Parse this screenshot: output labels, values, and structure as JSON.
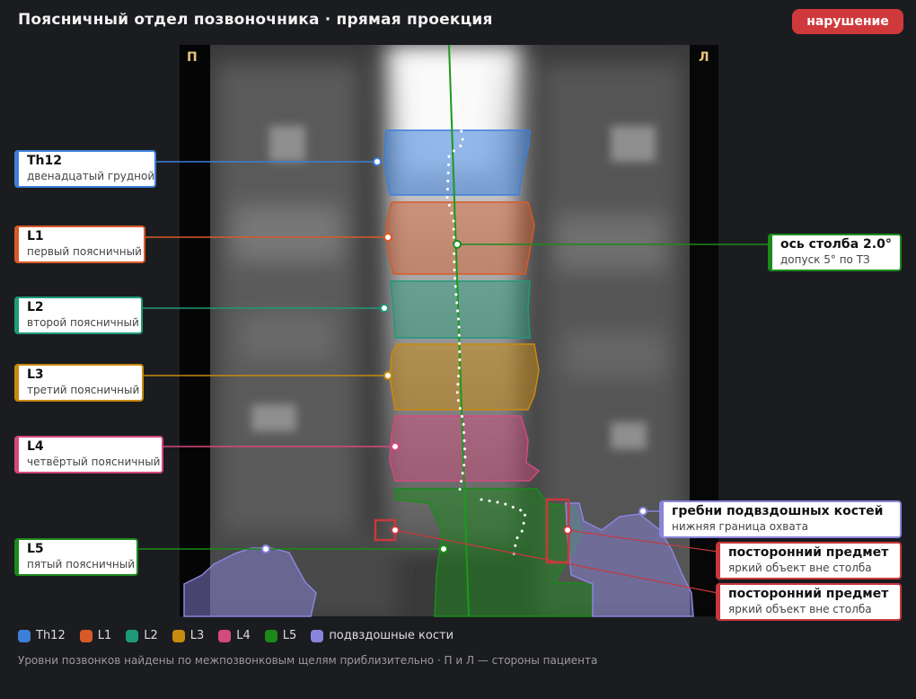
{
  "title": "Поясничный отдел позвоночника · прямая проекция",
  "status_badge": "нарушение",
  "side_labels": {
    "right": "П",
    "left": "Л"
  },
  "vertebrae": [
    {
      "id": "th12",
      "name": "Th12",
      "desc": "двенадцатый грудной",
      "color": "#3d7fd9"
    },
    {
      "id": "l1",
      "name": "L1",
      "desc": "первый поясничный",
      "color": "#d85a28"
    },
    {
      "id": "l2",
      "name": "L2",
      "desc": "второй поясничный",
      "color": "#1f9a78"
    },
    {
      "id": "l3",
      "name": "L3",
      "desc": "третий поясничный",
      "color": "#c98a10"
    },
    {
      "id": "l4",
      "name": "L4",
      "desc": "четвёртый поясничный",
      "color": "#d4497e"
    },
    {
      "id": "l5",
      "name": "L5",
      "desc": "пятый поясничный",
      "color": "#1b8a1b"
    }
  ],
  "axis": {
    "label": "ось столба 2.0°",
    "tolerance": "допуск 5° по ТЗ",
    "color": "#1b8a1b"
  },
  "iliac": {
    "label": "гребни подвздошных костей",
    "desc": "нижняя граница охвата",
    "color": "#8a84dc"
  },
  "foreign_objects": [
    {
      "label": "посторонний предмет",
      "desc": "яркий объект вне столба",
      "color": "#c8383c"
    },
    {
      "label": "посторонний предмет",
      "desc": "яркий объект вне столба",
      "color": "#c8383c"
    }
  ],
  "legend": [
    {
      "label": "Th12",
      "color": "#3d7fd9"
    },
    {
      "label": "L1",
      "color": "#d85a28"
    },
    {
      "label": "L2",
      "color": "#1f9a78"
    },
    {
      "label": "L3",
      "color": "#c98a10"
    },
    {
      "label": "L4",
      "color": "#d4497e"
    },
    {
      "label": "L5",
      "color": "#1b8a1b"
    },
    {
      "label": "подвздошные кости",
      "color": "#8a84dc"
    }
  ],
  "footnote": "Уровни позвонков найдены по межпозвонковым щелям приблизительно · П и Л — стороны пациента"
}
